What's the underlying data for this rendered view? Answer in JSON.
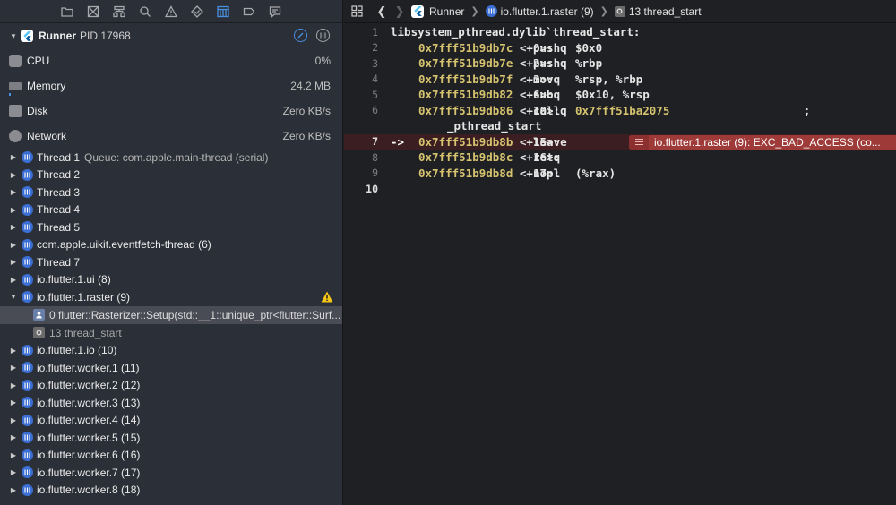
{
  "navigator": {
    "toolbar_icons": [
      "folder-icon",
      "source-control-icon",
      "hierarchy-icon",
      "search-icon",
      "issue-warning-icon",
      "test-diamond-icon",
      "debug-navigator-icon",
      "breakpoint-icon",
      "report-icon"
    ],
    "active_toolbar_icon": "debug-navigator-icon",
    "process": {
      "name": "Runner",
      "pid_label": "PID 17968"
    },
    "gauges": [
      {
        "label": "CPU",
        "value": "0%"
      },
      {
        "label": "Memory",
        "value": "24.2 MB"
      },
      {
        "label": "Disk",
        "value": "Zero KB/s"
      },
      {
        "label": "Network",
        "value": "Zero KB/s"
      }
    ],
    "threads": [
      {
        "label": "Thread 1",
        "extra": "Queue: com.apple.main-thread (serial)",
        "expanded": false
      },
      {
        "label": "Thread 2",
        "extra": "",
        "expanded": false
      },
      {
        "label": "Thread 3",
        "extra": "",
        "expanded": false
      },
      {
        "label": "Thread 4",
        "extra": "",
        "expanded": false
      },
      {
        "label": "Thread 5",
        "extra": "",
        "expanded": false
      },
      {
        "label": "com.apple.uikit.eventfetch-thread (6)",
        "extra": "",
        "expanded": false
      },
      {
        "label": "Thread 7",
        "extra": "",
        "expanded": false
      },
      {
        "label": "io.flutter.1.ui (8)",
        "extra": "",
        "expanded": false
      },
      {
        "label": "io.flutter.1.raster (9)",
        "extra": "",
        "expanded": true,
        "warning": true
      }
    ],
    "frames": [
      {
        "label": "0 flutter::Rasterizer::Setup(std::__1::unique_ptr<flutter::Surf...",
        "selected": true,
        "kind": "user"
      },
      {
        "label": "13 thread_start",
        "selected": false,
        "kind": "sys"
      }
    ],
    "threads_after": [
      {
        "label": "io.flutter.1.io (10)"
      },
      {
        "label": "io.flutter.worker.1 (11)"
      },
      {
        "label": "io.flutter.worker.2 (12)"
      },
      {
        "label": "io.flutter.worker.3 (13)"
      },
      {
        "label": "io.flutter.worker.4 (14)"
      },
      {
        "label": "io.flutter.worker.5 (15)"
      },
      {
        "label": "io.flutter.worker.6 (16)"
      },
      {
        "label": "io.flutter.worker.7 (17)"
      },
      {
        "label": "io.flutter.worker.8 (18)"
      }
    ]
  },
  "jumpbar": {
    "project": "Runner",
    "thread": "io.flutter.1.raster (9)",
    "frame": "13 thread_start"
  },
  "code": {
    "header": "libsystem_pthread.dylib`thread_start:",
    "pointer": "->",
    "instructions": [
      {
        "line": "2",
        "addr": "0x7fff51b9db7c",
        "offset": "<+0>:",
        "mnemonic": "pushq",
        "operands": "$0x0"
      },
      {
        "line": "3",
        "addr": "0x7fff51b9db7e",
        "offset": "<+2>:",
        "mnemonic": "pushq",
        "operands": "%rbp"
      },
      {
        "line": "4",
        "addr": "0x7fff51b9db7f",
        "offset": "<+3>:",
        "mnemonic": "movq",
        "operands": "%rsp, %rbp"
      },
      {
        "line": "5",
        "addr": "0x7fff51b9db82",
        "offset": "<+6>:",
        "mnemonic": "subq",
        "operands": "$0x10, %rsp"
      },
      {
        "line": "6",
        "addr": "0x7fff51b9db86",
        "offset": "<+10>:",
        "mnemonic": "callq",
        "operands": "0x7fff51ba2075",
        "comment": ";"
      },
      {
        "line": "7",
        "addr": "0x7fff51b9db8b",
        "offset": "<+15>:",
        "mnemonic": "leave",
        "operands": "",
        "current": true
      },
      {
        "line": "8",
        "addr": "0x7fff51b9db8c",
        "offset": "<+16>:",
        "mnemonic": "retq",
        "operands": ""
      },
      {
        "line": "9",
        "addr": "0x7fff51b9db8d",
        "offset": "<+17>:",
        "mnemonic": "nopl",
        "operands": "(%rax)"
      }
    ],
    "continuation": "_pthread_start",
    "line_numbers": [
      "1",
      "2",
      "3",
      "4",
      "5",
      "6",
      "",
      "7",
      "8",
      "9",
      "10"
    ],
    "error_message": "io.flutter.1.raster (9): EXC_BAD_ACCESS (co..."
  },
  "colors": {
    "accent": "#4a90e2",
    "address": "#d6c36f",
    "error_badge": "#9e3a38",
    "error_line": "#3b1e21",
    "warning": "#f5c518"
  }
}
